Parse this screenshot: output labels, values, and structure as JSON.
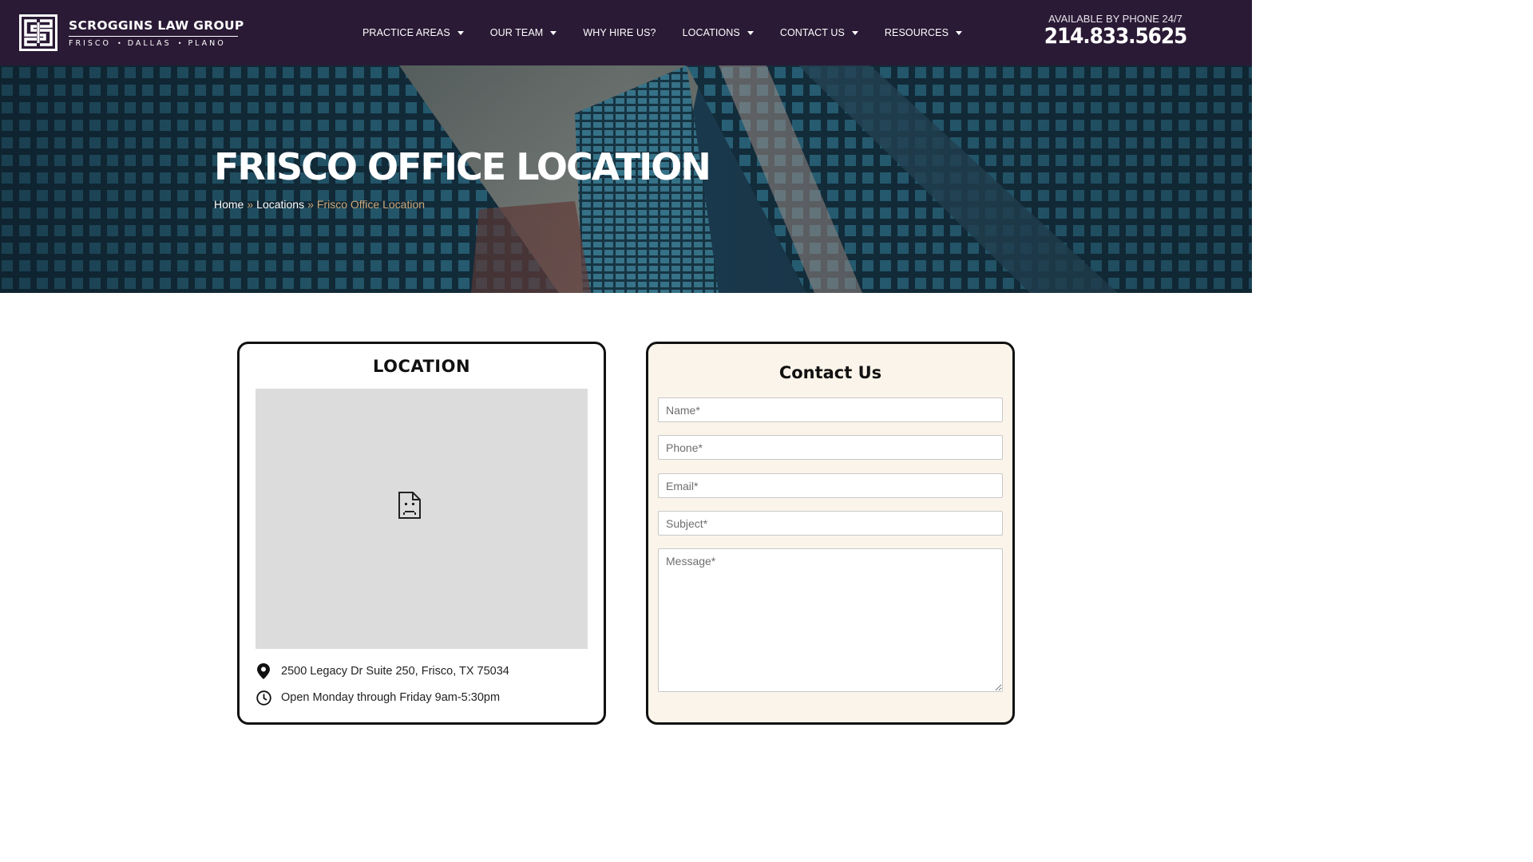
{
  "brand": {
    "name": "SCROGGINS LAW GROUP",
    "cities": [
      "FRISCO",
      "DALLAS",
      "PLANO"
    ],
    "color_header": "#2a1a35",
    "color_accent": "#c9a77a"
  },
  "nav": {
    "items": [
      {
        "label": "PRACTICE AREAS",
        "has_dropdown": true
      },
      {
        "label": "OUR TEAM",
        "has_dropdown": true
      },
      {
        "label": "WHY HIRE US?",
        "has_dropdown": false
      },
      {
        "label": "LOCATIONS",
        "has_dropdown": true
      },
      {
        "label": "CONTACT US",
        "has_dropdown": true
      },
      {
        "label": "RESOURCES",
        "has_dropdown": true
      }
    ]
  },
  "phone": {
    "label": "AVAILABLE BY PHONE 24/7",
    "number": "214.833.5625"
  },
  "hero": {
    "title": "FRISCO OFFICE LOCATION",
    "breadcrumb": {
      "home": "Home",
      "sep": "»",
      "locations": "Locations",
      "current": "Frisco Office Location"
    }
  },
  "location_card": {
    "title": "LOCATION",
    "map_icon": "broken-document-icon",
    "address_icon": "map-pin-icon",
    "address": "2500 Legacy Dr Suite 250, Frisco, TX 75034",
    "hours_icon": "clock-icon",
    "hours": "Open Monday through Friday 9am-5:30pm"
  },
  "contact_card": {
    "title": "Contact Us",
    "fields": {
      "name": "Name*",
      "phone": "Phone*",
      "email": "Email*",
      "subject": "Subject*",
      "message": "Message*"
    }
  }
}
